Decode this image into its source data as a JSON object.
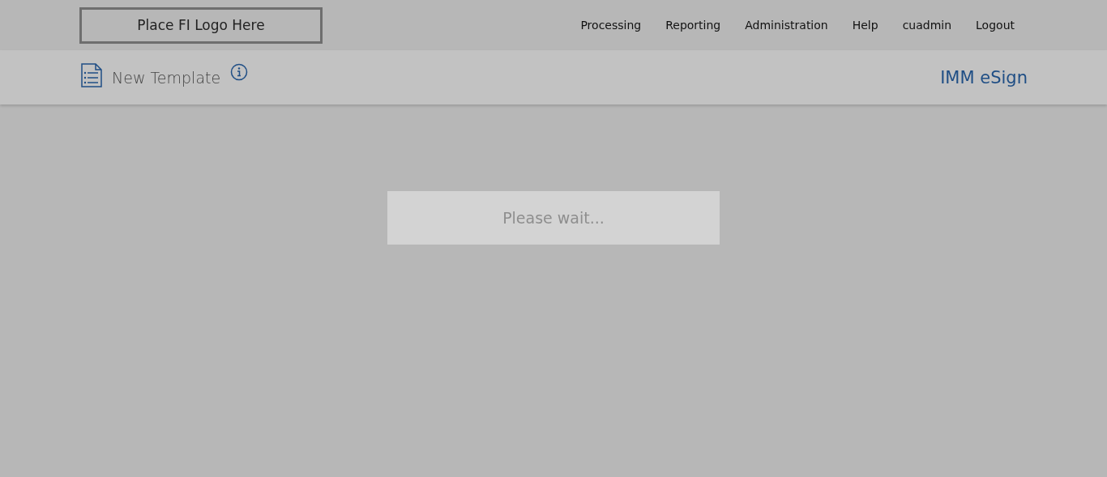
{
  "logo": "Place FI Logo Here",
  "nav": [
    "Processing",
    "Reporting",
    "Administration",
    "Help",
    "cuadmin",
    "Logout"
  ],
  "page": {
    "title": "New Template",
    "brand": "IMM eSign"
  },
  "loading": {
    "message": "Please wait..."
  }
}
